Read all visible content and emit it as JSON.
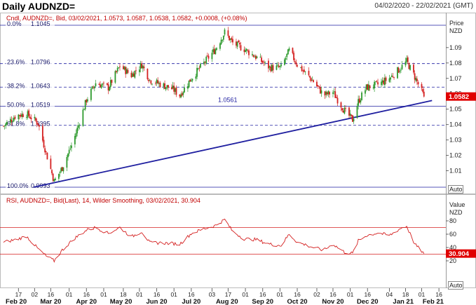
{
  "header": {
    "title": "Daily AUDNZD=",
    "date_range": "04/02/2020 - 22/02/2021 (GMT)"
  },
  "price_panel": {
    "info": "Cndl, AUDNZD=, Bid, 03/02/2021, 1.0573, 1.0587, 1.0538, 1.0582, +0.0008, (+0.08%)",
    "axis_title": "Price",
    "axis_unit": "NZD",
    "auto_label": "Auto",
    "last_price_label": "1.0582",
    "trend_label": "1.0561"
  },
  "rsi_panel": {
    "info": "RSI, AUDNZD=, Bid(Last), 14, Wilder Smoothing, 03/02/2021, 30.904",
    "axis_title": "Value",
    "axis_unit": "NZD",
    "auto_label": "Auto",
    "last_value_label": "30.904"
  },
  "colors": {
    "up": "#2e9a2e",
    "down": "#d42020",
    "trendline": "#1f1fa0",
    "fib": "#1f1fa0",
    "rsi_line": "#d42020",
    "rsi_level": "#d42020",
    "price_badge": "#e00000"
  },
  "chart_data": [
    {
      "type": "candlestick",
      "ylim": [
        1.0,
        1.1
      ],
      "y_ticks": [
        "1.01",
        "1.02",
        "1.03",
        "1.04",
        "1.05",
        "1.06",
        "1.07",
        "1.08",
        "1.09"
      ],
      "fib_levels": [
        {
          "pct": "0.0%",
          "value": "1.1045"
        },
        {
          "pct": "23.6%",
          "value": "1.0796"
        },
        {
          "pct": "38.2%",
          "value": "1.0643"
        },
        {
          "pct": "50.0%",
          "value": "1.0519"
        },
        {
          "pct": "61.8%",
          "value": "1.0395"
        },
        {
          "pct": "100.0%",
          "value": "0.9993"
        }
      ],
      "trendline": {
        "from": [
          "2020-03-01",
          0.9993
        ],
        "to": [
          "2021-02-10",
          1.0556
        ]
      },
      "key_points": [
        [
          "2020-02-04",
          1.039
        ],
        [
          "2020-02-15",
          1.046
        ],
        [
          "2020-02-24",
          1.047
        ],
        [
          "2020-03-05",
          1.041
        ],
        [
          "2020-03-10",
          1.027
        ],
        [
          "2020-03-19",
          1.003
        ],
        [
          "2020-03-26",
          1.012
        ],
        [
          "2020-04-05",
          1.03
        ],
        [
          "2020-04-16",
          1.056
        ],
        [
          "2020-04-24",
          1.067
        ],
        [
          "2020-05-05",
          1.064
        ],
        [
          "2020-05-15",
          1.078
        ],
        [
          "2020-05-25",
          1.072
        ],
        [
          "2020-06-03",
          1.079
        ],
        [
          "2020-06-10",
          1.069
        ],
        [
          "2020-06-20",
          1.066
        ],
        [
          "2020-06-30",
          1.063
        ],
        [
          "2020-07-06",
          1.059
        ],
        [
          "2020-07-16",
          1.07
        ],
        [
          "2020-07-27",
          1.08
        ],
        [
          "2020-08-06",
          1.089
        ],
        [
          "2020-08-14",
          1.1
        ],
        [
          "2020-08-21",
          1.093
        ],
        [
          "2020-08-31",
          1.089
        ],
        [
          "2020-09-10",
          1.084
        ],
        [
          "2020-09-22",
          1.077
        ],
        [
          "2020-10-02",
          1.077
        ],
        [
          "2020-10-09",
          1.088
        ],
        [
          "2020-10-16",
          1.079
        ],
        [
          "2020-10-30",
          1.068
        ],
        [
          "2020-11-08",
          1.059
        ],
        [
          "2020-11-16",
          1.061
        ],
        [
          "2020-11-26",
          1.049
        ],
        [
          "2020-12-03",
          1.043
        ],
        [
          "2020-12-08",
          1.055
        ],
        [
          "2020-12-15",
          1.064
        ],
        [
          "2020-12-25",
          1.066
        ],
        [
          "2021-01-04",
          1.07
        ],
        [
          "2021-01-14",
          1.077
        ],
        [
          "2021-01-19",
          1.081
        ],
        [
          "2021-01-26",
          1.071
        ],
        [
          "2021-02-03",
          1.0582
        ]
      ]
    },
    {
      "type": "line",
      "name": "RSI",
      "ylim": [
        0,
        100
      ],
      "y_ticks": [
        "20",
        "40",
        "60",
        "80"
      ],
      "levels": [
        70,
        30
      ],
      "key_points": [
        [
          "2020-02-04",
          48
        ],
        [
          "2020-02-15",
          52
        ],
        [
          "2020-02-24",
          57
        ],
        [
          "2020-03-05",
          38
        ],
        [
          "2020-03-12",
          27
        ],
        [
          "2020-03-19",
          20
        ],
        [
          "2020-03-26",
          36
        ],
        [
          "2020-04-05",
          53
        ],
        [
          "2020-04-16",
          66
        ],
        [
          "2020-04-24",
          70
        ],
        [
          "2020-05-05",
          61
        ],
        [
          "2020-05-15",
          70
        ],
        [
          "2020-05-25",
          56
        ],
        [
          "2020-06-03",
          64
        ],
        [
          "2020-06-10",
          47
        ],
        [
          "2020-06-20",
          47
        ],
        [
          "2020-06-30",
          46
        ],
        [
          "2020-07-06",
          45
        ],
        [
          "2020-07-16",
          61
        ],
        [
          "2020-07-27",
          68
        ],
        [
          "2020-08-06",
          73
        ],
        [
          "2020-08-14",
          82
        ],
        [
          "2020-08-21",
          64
        ],
        [
          "2020-08-31",
          53
        ],
        [
          "2020-09-10",
          52
        ],
        [
          "2020-09-22",
          45
        ],
        [
          "2020-10-02",
          43
        ],
        [
          "2020-10-09",
          60
        ],
        [
          "2020-10-16",
          48
        ],
        [
          "2020-10-30",
          40
        ],
        [
          "2020-11-08",
          36
        ],
        [
          "2020-11-16",
          45
        ],
        [
          "2020-11-26",
          33
        ],
        [
          "2020-12-03",
          31
        ],
        [
          "2020-12-08",
          50
        ],
        [
          "2020-12-15",
          58
        ],
        [
          "2020-12-25",
          62
        ],
        [
          "2021-01-04",
          58
        ],
        [
          "2021-01-14",
          69
        ],
        [
          "2021-01-19",
          72
        ],
        [
          "2021-01-26",
          45
        ],
        [
          "2021-02-03",
          30.904
        ]
      ]
    }
  ],
  "x_axis": {
    "day_ticks": [
      {
        "date": "2020-02-17",
        "label": "17"
      },
      {
        "date": "2020-03-02",
        "label": "02"
      },
      {
        "date": "2020-03-16",
        "label": "16"
      },
      {
        "date": "2020-04-01",
        "label": "01"
      },
      {
        "date": "2020-04-16",
        "label": "16"
      },
      {
        "date": "2020-05-01",
        "label": "01"
      },
      {
        "date": "2020-05-18",
        "label": "18"
      },
      {
        "date": "2020-06-01",
        "label": "01"
      },
      {
        "date": "2020-06-16",
        "label": "16"
      },
      {
        "date": "2020-07-01",
        "label": "01"
      },
      {
        "date": "2020-07-16",
        "label": "16"
      },
      {
        "date": "2020-08-03",
        "label": "03"
      },
      {
        "date": "2020-08-17",
        "label": "17"
      },
      {
        "date": "2020-09-01",
        "label": "01"
      },
      {
        "date": "2020-09-16",
        "label": "16"
      },
      {
        "date": "2020-10-01",
        "label": "01"
      },
      {
        "date": "2020-10-16",
        "label": "16"
      },
      {
        "date": "2020-11-02",
        "label": "02"
      },
      {
        "date": "2020-11-16",
        "label": "16"
      },
      {
        "date": "2020-12-01",
        "label": "01"
      },
      {
        "date": "2020-12-16",
        "label": "16"
      },
      {
        "date": "2021-01-04",
        "label": "04"
      },
      {
        "date": "2021-01-18",
        "label": "18"
      },
      {
        "date": "2021-02-01",
        "label": "01"
      },
      {
        "date": "2021-02-16",
        "label": "16"
      }
    ],
    "month_labels": [
      {
        "date": "2020-02-15",
        "label": "Feb 20"
      },
      {
        "date": "2020-03-16",
        "label": "Mar 20"
      },
      {
        "date": "2020-04-16",
        "label": "Apr 20"
      },
      {
        "date": "2020-05-16",
        "label": "May 20"
      },
      {
        "date": "2020-06-16",
        "label": "Jun 20"
      },
      {
        "date": "2020-07-16",
        "label": "Jul 20"
      },
      {
        "date": "2020-08-16",
        "label": "Aug 20"
      },
      {
        "date": "2020-09-16",
        "label": "Sep 20"
      },
      {
        "date": "2020-10-16",
        "label": "Oct 20"
      },
      {
        "date": "2020-11-16",
        "label": "Nov 20"
      },
      {
        "date": "2020-12-16",
        "label": "Dec 20"
      },
      {
        "date": "2021-01-16",
        "label": "Jan 21"
      },
      {
        "date": "2021-02-11",
        "label": "Feb 21"
      }
    ]
  }
}
